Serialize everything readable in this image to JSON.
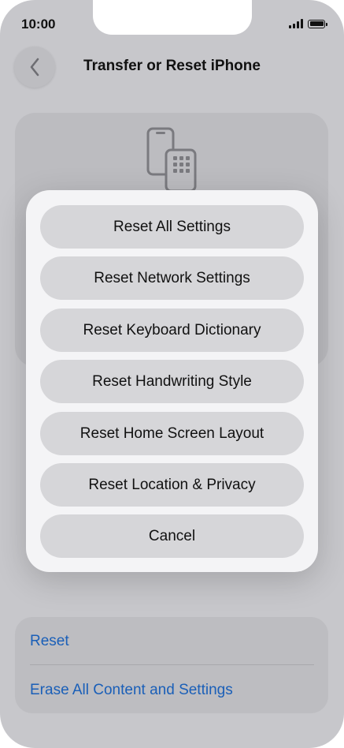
{
  "status_bar": {
    "time": "10:00"
  },
  "nav": {
    "title": "Transfer or Reset iPhone",
    "back_icon": "chevron-left-icon"
  },
  "reset_menu": {
    "items": [
      {
        "label": "Reset All Settings"
      },
      {
        "label": "Reset Network Settings"
      },
      {
        "label": "Reset Keyboard Dictionary"
      },
      {
        "label": "Reset Handwriting Style"
      },
      {
        "label": "Reset Home Screen Layout"
      },
      {
        "label": "Reset Location & Privacy"
      }
    ],
    "cancel_label": "Cancel"
  },
  "bottom_list": {
    "reset_label": "Reset",
    "erase_label": "Erase All Content and Settings"
  },
  "colors": {
    "background": "#c7c7cb",
    "sheet": "#f4f4f6",
    "button": "#d6d6d9",
    "link": "#1a5fb8"
  }
}
